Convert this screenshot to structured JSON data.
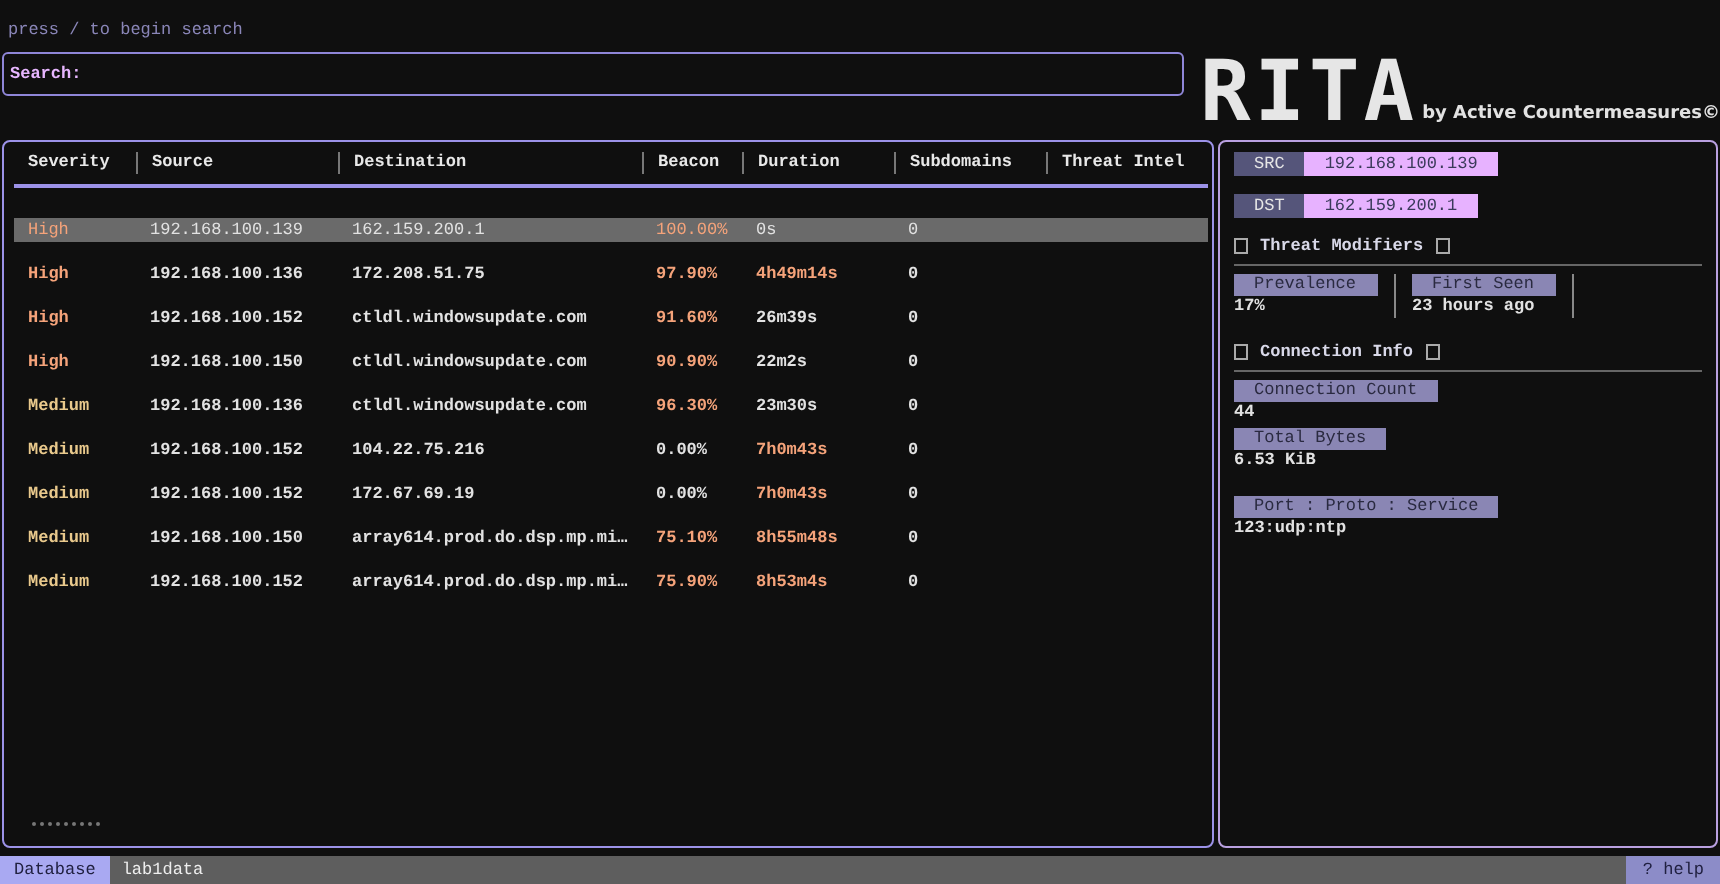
{
  "search_hint": "press / to begin search",
  "search": {
    "label": "Search:"
  },
  "logo": {
    "title": "RITA",
    "byline": "by Active Countermeasures©"
  },
  "table": {
    "columns": [
      "Severity",
      "Source",
      "Destination",
      "Beacon",
      "Duration",
      "Subdomains",
      "Threat Intel"
    ],
    "rows": [
      {
        "severity": "High",
        "kind": "high",
        "source": "192.168.100.139",
        "destination": "162.159.200.1",
        "beacon": "100.00%",
        "beacon_flagged": true,
        "duration": "0s",
        "duration_flagged": false,
        "subdomains": "0",
        "selected": true
      },
      {
        "severity": "High",
        "kind": "high",
        "source": "192.168.100.136",
        "destination": "172.208.51.75",
        "beacon": "97.90%",
        "beacon_flagged": true,
        "duration": "4h49m14s",
        "duration_flagged": true,
        "subdomains": "0",
        "selected": false
      },
      {
        "severity": "High",
        "kind": "high",
        "source": "192.168.100.152",
        "destination": "ctldl.windowsupdate.com",
        "beacon": "91.60%",
        "beacon_flagged": true,
        "duration": "26m39s",
        "duration_flagged": false,
        "subdomains": "0",
        "selected": false
      },
      {
        "severity": "High",
        "kind": "high",
        "source": "192.168.100.150",
        "destination": "ctldl.windowsupdate.com",
        "beacon": "90.90%",
        "beacon_flagged": true,
        "duration": "22m2s",
        "duration_flagged": false,
        "subdomains": "0",
        "selected": false
      },
      {
        "severity": "Medium",
        "kind": "medium",
        "source": "192.168.100.136",
        "destination": "ctldl.windowsupdate.com",
        "beacon": "96.30%",
        "beacon_flagged": true,
        "duration": "23m30s",
        "duration_flagged": false,
        "subdomains": "0",
        "selected": false
      },
      {
        "severity": "Medium",
        "kind": "medium",
        "source": "192.168.100.152",
        "destination": "104.22.75.216",
        "beacon": "0.00%",
        "beacon_flagged": false,
        "duration": "7h0m43s",
        "duration_flagged": true,
        "subdomains": "0",
        "selected": false
      },
      {
        "severity": "Medium",
        "kind": "medium",
        "source": "192.168.100.152",
        "destination": "172.67.69.19",
        "beacon": "0.00%",
        "beacon_flagged": false,
        "duration": "7h0m43s",
        "duration_flagged": true,
        "subdomains": "0",
        "selected": false
      },
      {
        "severity": "Medium",
        "kind": "medium",
        "source": "192.168.100.150",
        "destination": "array614.prod.do.dsp.mp.mi…",
        "beacon": "75.10%",
        "beacon_flagged": true,
        "duration": "8h55m48s",
        "duration_flagged": true,
        "subdomains": "0",
        "selected": false
      },
      {
        "severity": "Medium",
        "kind": "medium",
        "source": "192.168.100.152",
        "destination": "array614.prod.do.dsp.mp.mi…",
        "beacon": "75.90%",
        "beacon_flagged": true,
        "duration": "8h53m4s",
        "duration_flagged": true,
        "subdomains": "0",
        "selected": false
      }
    ]
  },
  "details": {
    "src": {
      "label": "SRC",
      "value": "192.168.100.139"
    },
    "dst": {
      "label": "DST",
      "value": "162.159.200.1"
    },
    "sections": [
      {
        "title": "Threat Modifiers",
        "kind": "columns",
        "fields": [
          {
            "label": "Prevalence",
            "value": "17%"
          },
          {
            "label": "First Seen",
            "value": "23 hours ago"
          }
        ]
      },
      {
        "title": "Connection Info",
        "kind": "stacked",
        "fields": [
          {
            "label": "Connection Count",
            "value": "44"
          },
          {
            "label": "Total Bytes",
            "value": "6.53 KiB"
          },
          {
            "label": "Port : Proto : Service",
            "value": "123:udp:ntp",
            "gap": true
          }
        ]
      }
    ]
  },
  "status_bar": {
    "label": "Database",
    "value": "lab1data",
    "help": "? help"
  }
}
